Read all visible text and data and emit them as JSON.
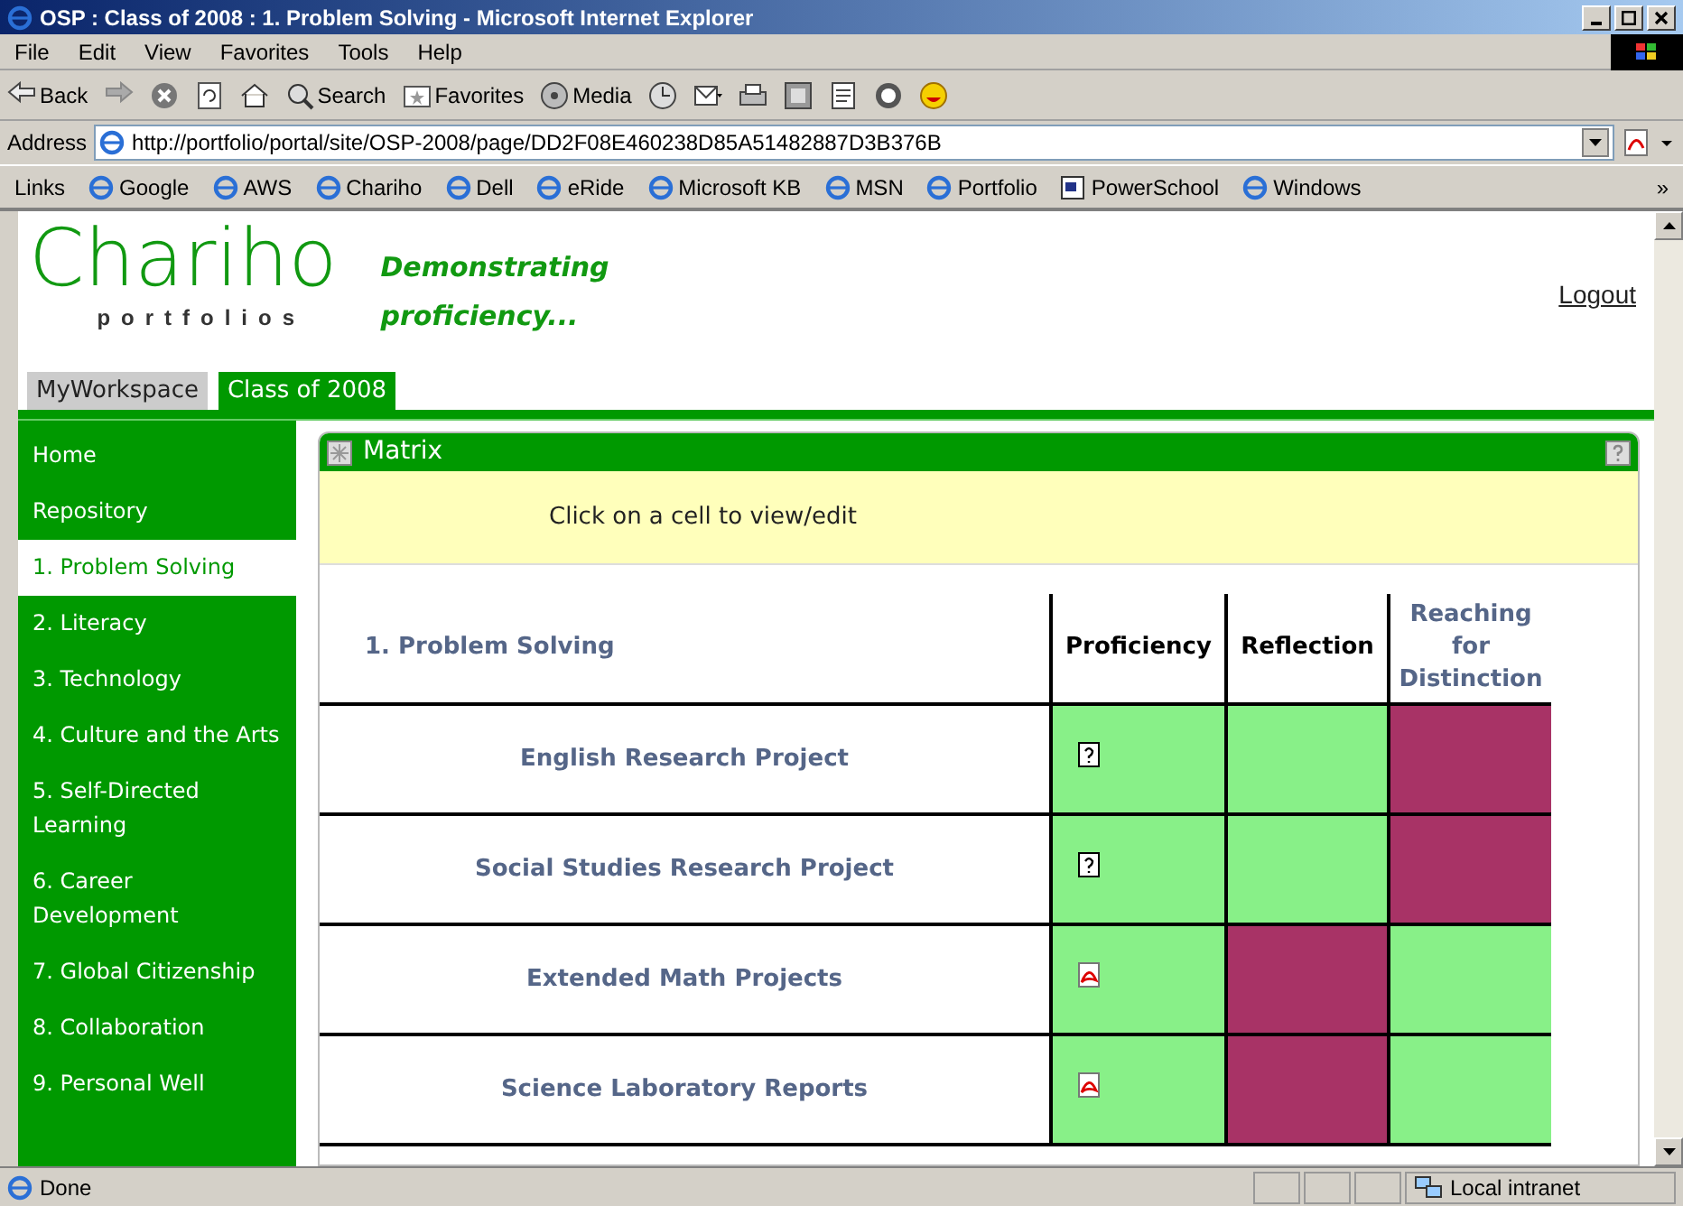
{
  "window": {
    "title": "OSP : Class of 2008 : 1. Problem Solving - Microsoft Internet Explorer"
  },
  "menu": [
    "File",
    "Edit",
    "View",
    "Favorites",
    "Tools",
    "Help"
  ],
  "toolbar": [
    {
      "kind": "back",
      "label": "Back"
    },
    {
      "kind": "forward"
    },
    {
      "kind": "stop"
    },
    {
      "kind": "refresh"
    },
    {
      "kind": "home"
    },
    {
      "kind": "search",
      "label": "Search"
    },
    {
      "kind": "favorites",
      "label": "Favorites"
    },
    {
      "kind": "media",
      "label": "Media"
    },
    {
      "kind": "history"
    },
    {
      "kind": "mail"
    },
    {
      "kind": "print"
    },
    {
      "kind": "edit"
    },
    {
      "kind": "discuss"
    },
    {
      "kind": "messenger"
    },
    {
      "kind": "research"
    }
  ],
  "address": {
    "label": "Address",
    "value": "http://portfolio/portal/site/OSP-2008/page/DD2F08E460238D85A51482887D3B376B"
  },
  "links": {
    "label": "Links",
    "more": "»",
    "items": [
      {
        "label": "Google",
        "kind": "ie"
      },
      {
        "label": "AWS",
        "kind": "ie"
      },
      {
        "label": "Chariho",
        "kind": "ie"
      },
      {
        "label": "Dell",
        "kind": "ie"
      },
      {
        "label": "eRide",
        "kind": "ie"
      },
      {
        "label": "Microsoft KB",
        "kind": "ie"
      },
      {
        "label": "MSN",
        "kind": "ie"
      },
      {
        "label": "Portfolio",
        "kind": "ie"
      },
      {
        "label": "PowerSchool",
        "kind": "doc"
      },
      {
        "label": "Windows",
        "kind": "ie"
      }
    ]
  },
  "header": {
    "logo": "Chariho",
    "logo_sub": "portfolios",
    "tagline_1": "Demonstrating",
    "tagline_2": "proficiency...",
    "logout": "Logout"
  },
  "site_tabs": [
    {
      "label": "MyWorkspace",
      "selected": false
    },
    {
      "label": "Class of 2008",
      "selected": true
    }
  ],
  "sidebar": {
    "items": [
      {
        "label": "Home",
        "selected": false
      },
      {
        "label": "Repository",
        "selected": false
      },
      {
        "label": "1. Problem Solving",
        "selected": true
      },
      {
        "label": "2. Literacy",
        "selected": false
      },
      {
        "label": "3. Technology",
        "selected": false
      },
      {
        "label": "4. Culture and the Arts",
        "selected": false
      },
      {
        "label": "5. Self-Directed Learning",
        "selected": false
      },
      {
        "label": "6. Career Development",
        "selected": false
      },
      {
        "label": "7. Global Citizenship",
        "selected": false
      },
      {
        "label": "8. Collaboration",
        "selected": false
      },
      {
        "label": "9. Personal Well",
        "selected": false
      }
    ]
  },
  "matrix": {
    "title": "Matrix",
    "instruction": "Click on a cell to view/edit",
    "heading": "1. Problem Solving",
    "columns": [
      "Proficiency",
      "Reflection",
      "Reaching for Distinction"
    ],
    "rows": [
      {
        "label": "English Research Project",
        "cells": [
          {
            "color": "#88f088",
            "kind": "doc"
          },
          {
            "color": "#88f088",
            "kind": "empty"
          },
          {
            "color": "#a83366",
            "kind": "empty"
          }
        ]
      },
      {
        "label": "Social Studies Research Project",
        "cells": [
          {
            "color": "#88f088",
            "kind": "doc"
          },
          {
            "color": "#88f088",
            "kind": "empty"
          },
          {
            "color": "#a83366",
            "kind": "empty"
          }
        ]
      },
      {
        "label": "Extended Math Projects",
        "cells": [
          {
            "color": "#88f088",
            "kind": "pdf"
          },
          {
            "color": "#a83366",
            "kind": "empty"
          },
          {
            "color": "#88f088",
            "kind": "empty"
          }
        ]
      },
      {
        "label": "Science Laboratory Reports",
        "cells": [
          {
            "color": "#88f088",
            "kind": "pdf"
          },
          {
            "color": "#a83366",
            "kind": "empty"
          },
          {
            "color": "#88f088",
            "kind": "empty"
          }
        ]
      }
    ]
  },
  "status_bar": {
    "text": "Done",
    "zone": "Local intranet"
  }
}
